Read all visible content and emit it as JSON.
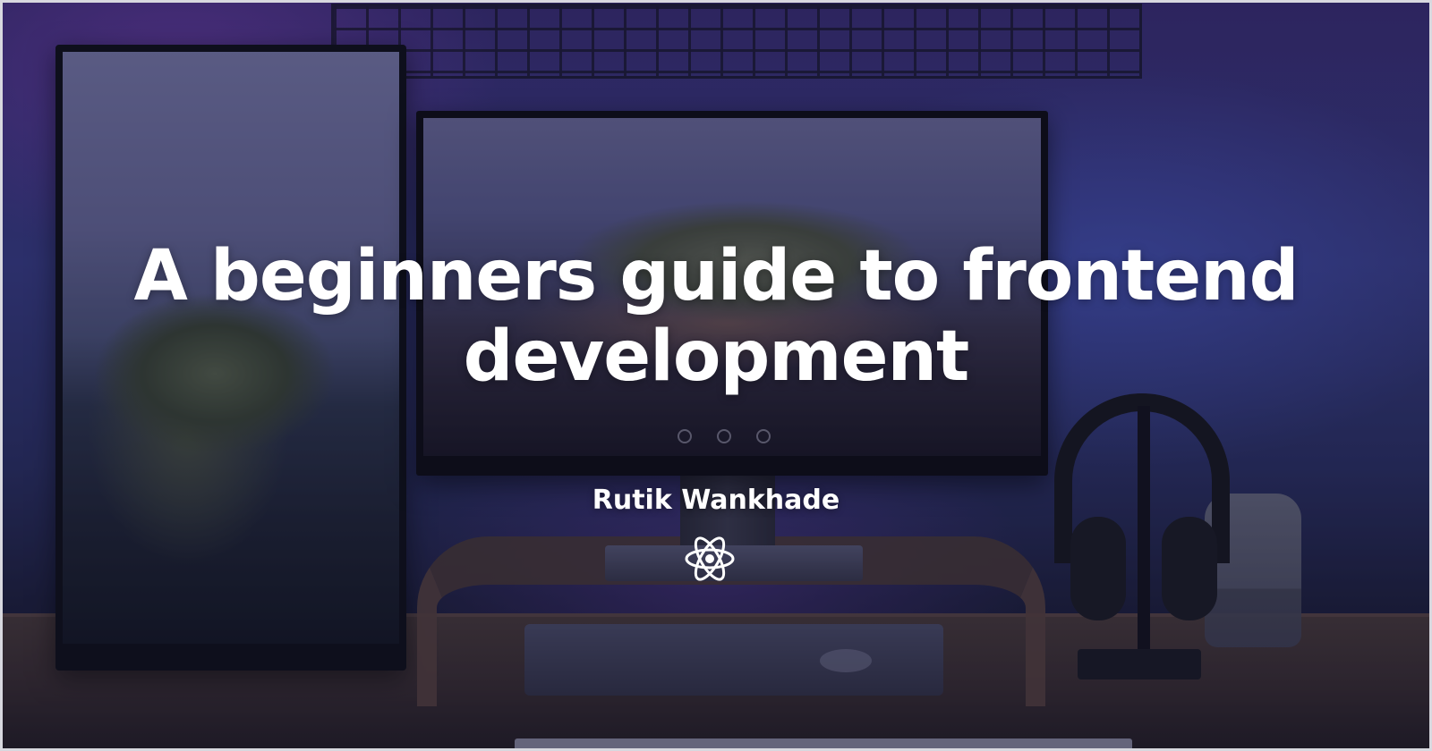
{
  "cover": {
    "title": "A beginners guide to frontend development",
    "author": "Rutik Wankhade",
    "logo_icon": "react-icon",
    "text_color": "#ffffff",
    "overlay_tint": "#0e1024"
  }
}
